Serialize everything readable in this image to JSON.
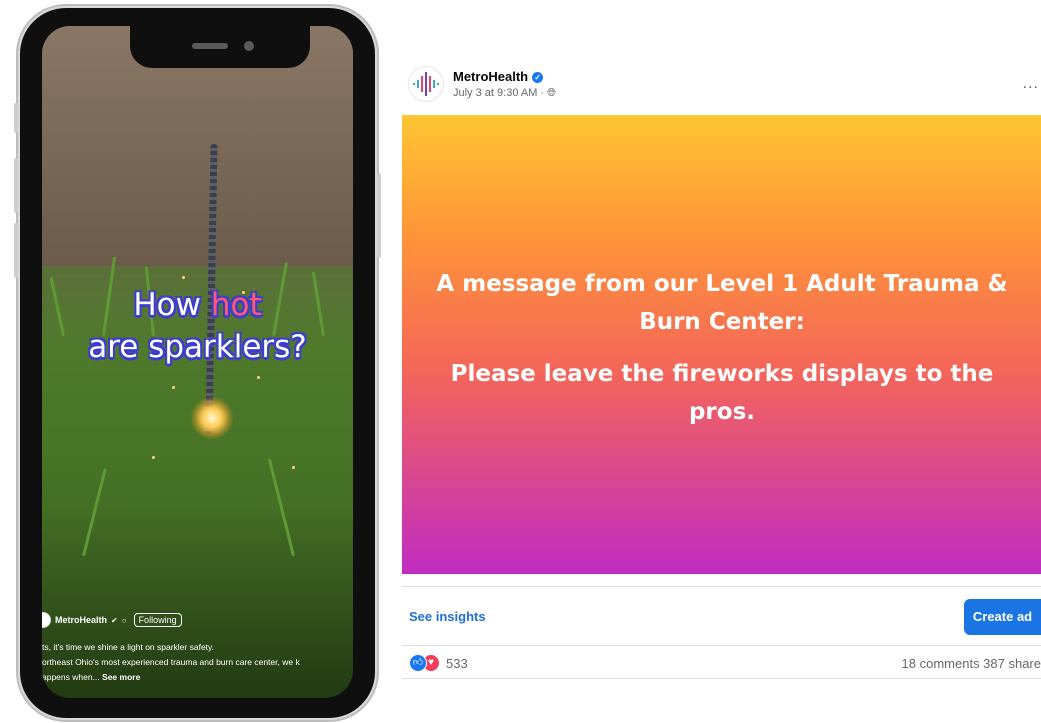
{
  "reel": {
    "headline_part1": "How ",
    "headline_hot": "hot",
    "headline_part2": "are sparklers?",
    "username": "MetroHealth",
    "following_label": "Following",
    "caption_line1": "ts, it's time we shine a light on sparkler safety.",
    "caption_line2": "ortheast Ohio's most experienced trauma and burn care center, we k",
    "caption_line3": "appens when...",
    "see_more": "See more"
  },
  "post": {
    "page_name": "MetroHealth",
    "timestamp": "July 3 at 9:30 AM ·",
    "more_icon": "...",
    "text_line1": "A message from our Level 1 Adult Trauma & Burn Center:",
    "text_line2": "Please leave the fireworks displays to the pros.",
    "gradient_colors": [
      "#fec533",
      "#fe9538",
      "#f4655a",
      "#c02cc2"
    ],
    "see_insights": "See insights",
    "create_ad": "Create ad",
    "reaction_count": "533",
    "comments_shares": "18 comments  387 share"
  }
}
